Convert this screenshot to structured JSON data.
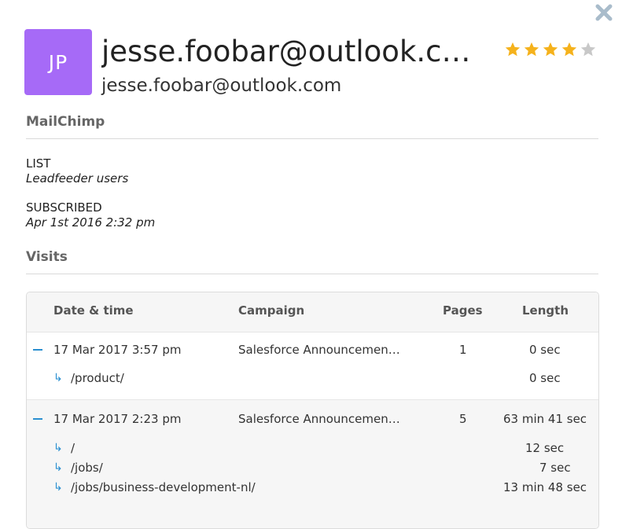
{
  "header": {
    "avatar_initials": "JP",
    "avatar_color": "#a66af7",
    "name_title": "jesse.foobar@outlook.com",
    "email": "jesse.foobar@outlook.com",
    "rating": {
      "value": 4,
      "max": 5
    }
  },
  "mailchimp": {
    "heading": "MailChimp",
    "list_label": "LIST",
    "list_value": "Leadfeeder users",
    "subscribed_label": "SUBSCRIBED",
    "subscribed_value": "Apr 1st 2016 2:32 pm"
  },
  "visits": {
    "heading": "Visits",
    "columns": {
      "date": "Date & time",
      "campaign": "Campaign",
      "pages": "Pages",
      "length": "Length"
    },
    "rows": [
      {
        "date": "17 Mar 2017 3:57 pm",
        "campaign": "Salesforce Announcemen…",
        "pages": "1",
        "length": "0 sec",
        "page_views": [
          {
            "path": "/product/",
            "length": "0 sec"
          }
        ]
      },
      {
        "date": "17 Mar 2017 2:23 pm",
        "campaign": "Salesforce Announcemen…",
        "pages": "5",
        "length": "63 min 41 sec",
        "page_views": [
          {
            "path": "/",
            "length": "12 sec"
          },
          {
            "path": "/jobs/",
            "length": "7 sec"
          },
          {
            "path": "/jobs/business-development-nl/",
            "length": "13 min 48 sec"
          }
        ]
      }
    ]
  },
  "colors": {
    "accent_blue": "#2a8fd0",
    "star_filled": "#f5b21c",
    "star_empty": "#c8c8c8",
    "close_icon": "#a9bccb"
  }
}
